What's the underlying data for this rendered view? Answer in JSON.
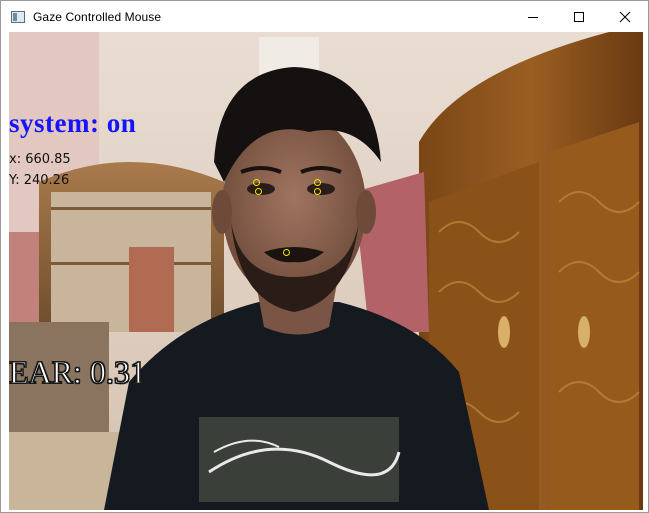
{
  "window": {
    "title": "Gaze Controlled Mouse",
    "icon": "app-window-icon",
    "controls": [
      "minimize-icon",
      "maximize-icon",
      "close-icon"
    ]
  },
  "overlay": {
    "system_status": "system: on",
    "system_status_color": "#1414ff",
    "x_readout": "x: 660.85",
    "y_readout": "Y: 240.26",
    "ear_readout": "EAR: 0.31"
  },
  "landmarks": {
    "color": "#f2e600",
    "labels": [
      "left-eye-top",
      "left-eye-bottom",
      "right-eye-top",
      "right-eye-bottom",
      "nose-tip"
    ]
  }
}
